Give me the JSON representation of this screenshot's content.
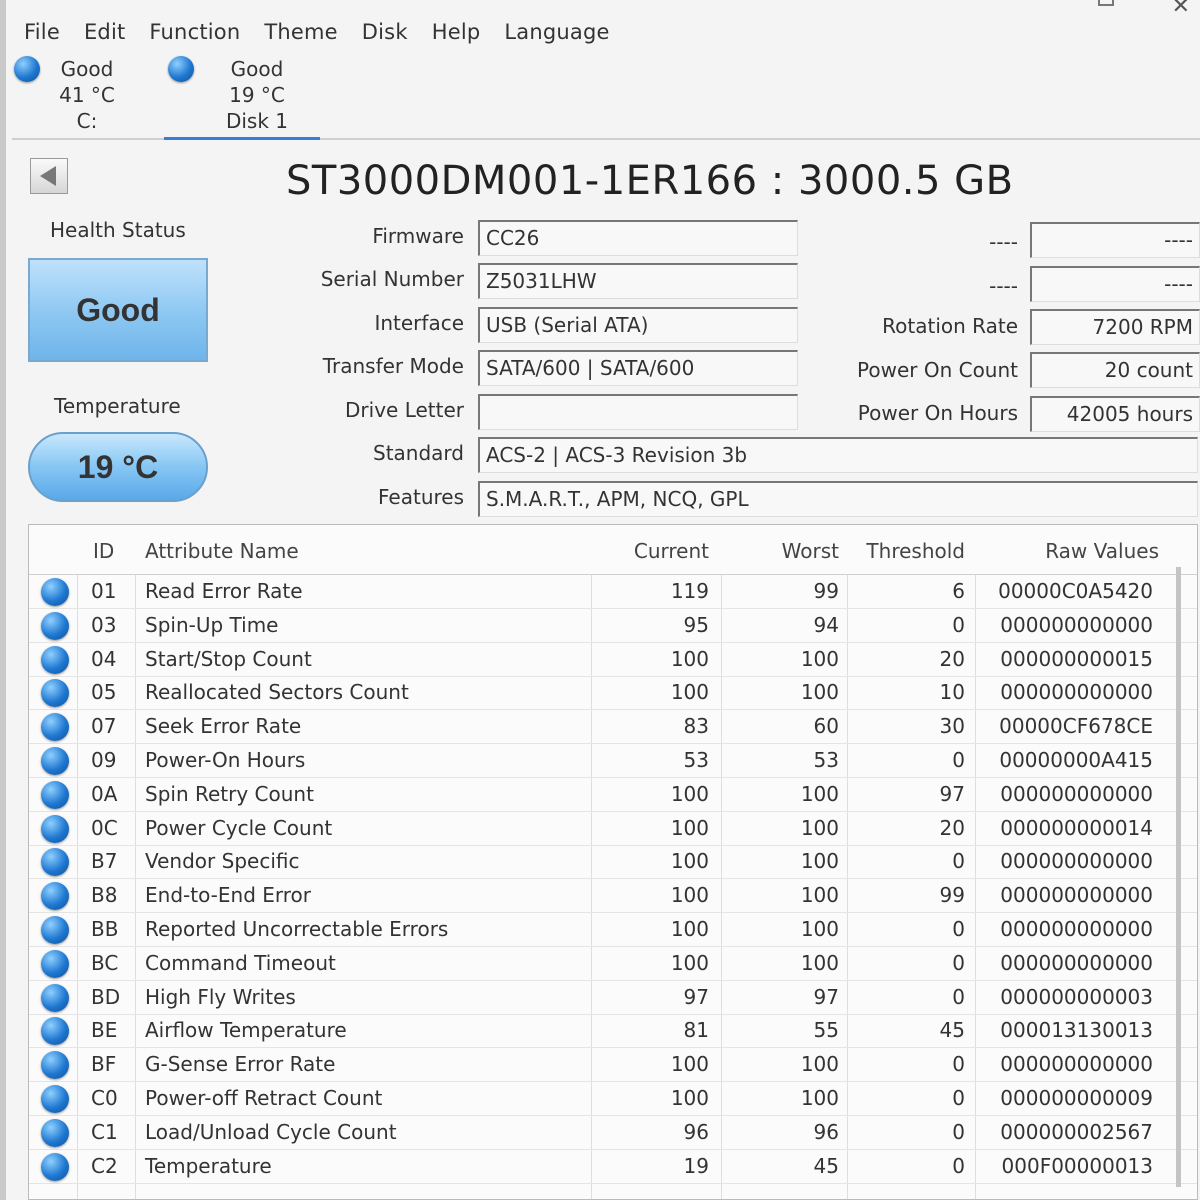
{
  "menu": [
    "File",
    "Edit",
    "Function",
    "Theme",
    "Disk",
    "Help",
    "Language"
  ],
  "disk_tabs": [
    {
      "status": "Good",
      "temp": "41 °C",
      "name": "C:"
    },
    {
      "status": "Good",
      "temp": "19 °C",
      "name": "Disk 1"
    }
  ],
  "drive": {
    "title": "ST3000DM001-1ER166 : 3000.5 GB"
  },
  "health": {
    "label": "Health Status",
    "value": "Good"
  },
  "temperature": {
    "label": "Temperature",
    "value": "19 °C"
  },
  "info": {
    "firmware_label": "Firmware",
    "firmware": "CC26",
    "serial_label": "Serial Number",
    "serial": "Z5031LHW",
    "interface_label": "Interface",
    "interface": "USB (Serial ATA)",
    "transfer_label": "Transfer Mode",
    "transfer": "SATA/600 | SATA/600",
    "drive_letter_label": "Drive Letter",
    "drive_letter": "",
    "standard_label": "Standard",
    "standard": "ACS-2 | ACS-3 Revision 3b",
    "features_label": "Features",
    "features": "S.M.A.R.T., APM, NCQ, GPL"
  },
  "right_info": {
    "blank1_label": "----",
    "blank1_value": "----",
    "blank2_label": "----",
    "blank2_value": "----",
    "rotation_label": "Rotation Rate",
    "rotation": "7200 RPM",
    "power_on_count_label": "Power On Count",
    "power_on_count": "20 count",
    "power_on_hours_label": "Power On Hours",
    "power_on_hours": "42005 hours"
  },
  "table": {
    "headers": {
      "id": "ID",
      "name": "Attribute Name",
      "current": "Current",
      "worst": "Worst",
      "threshold": "Threshold",
      "raw": "Raw Values"
    },
    "rows": [
      {
        "id": "01",
        "name": "Read Error Rate",
        "current": "119",
        "worst": "99",
        "threshold": "6",
        "raw": "00000C0A5420"
      },
      {
        "id": "03",
        "name": "Spin-Up Time",
        "current": "95",
        "worst": "94",
        "threshold": "0",
        "raw": "000000000000"
      },
      {
        "id": "04",
        "name": "Start/Stop Count",
        "current": "100",
        "worst": "100",
        "threshold": "20",
        "raw": "000000000015"
      },
      {
        "id": "05",
        "name": "Reallocated Sectors Count",
        "current": "100",
        "worst": "100",
        "threshold": "10",
        "raw": "000000000000"
      },
      {
        "id": "07",
        "name": "Seek Error Rate",
        "current": "83",
        "worst": "60",
        "threshold": "30",
        "raw": "00000CF678CE"
      },
      {
        "id": "09",
        "name": "Power-On Hours",
        "current": "53",
        "worst": "53",
        "threshold": "0",
        "raw": "00000000A415"
      },
      {
        "id": "0A",
        "name": "Spin Retry Count",
        "current": "100",
        "worst": "100",
        "threshold": "97",
        "raw": "000000000000"
      },
      {
        "id": "0C",
        "name": "Power Cycle Count",
        "current": "100",
        "worst": "100",
        "threshold": "20",
        "raw": "000000000014"
      },
      {
        "id": "B7",
        "name": "Vendor Specific",
        "current": "100",
        "worst": "100",
        "threshold": "0",
        "raw": "000000000000"
      },
      {
        "id": "B8",
        "name": "End-to-End Error",
        "current": "100",
        "worst": "100",
        "threshold": "99",
        "raw": "000000000000"
      },
      {
        "id": "BB",
        "name": "Reported Uncorrectable Errors",
        "current": "100",
        "worst": "100",
        "threshold": "0",
        "raw": "000000000000"
      },
      {
        "id": "BC",
        "name": "Command Timeout",
        "current": "100",
        "worst": "100",
        "threshold": "0",
        "raw": "000000000000"
      },
      {
        "id": "BD",
        "name": "High Fly Writes",
        "current": "97",
        "worst": "97",
        "threshold": "0",
        "raw": "000000000003"
      },
      {
        "id": "BE",
        "name": "Airflow Temperature",
        "current": "81",
        "worst": "55",
        "threshold": "45",
        "raw": "000013130013"
      },
      {
        "id": "BF",
        "name": "G-Sense Error Rate",
        "current": "100",
        "worst": "100",
        "threshold": "0",
        "raw": "000000000000"
      },
      {
        "id": "C0",
        "name": "Power-off Retract Count",
        "current": "100",
        "worst": "100",
        "threshold": "0",
        "raw": "000000000009"
      },
      {
        "id": "C1",
        "name": "Load/Unload Cycle Count",
        "current": "96",
        "worst": "96",
        "threshold": "0",
        "raw": "000000002567"
      },
      {
        "id": "C2",
        "name": "Temperature",
        "current": "19",
        "worst": "45",
        "threshold": "0",
        "raw": "000F00000013"
      }
    ]
  },
  "colors": {
    "status_good": "#1f78d1",
    "health_box": "#8cc7f2"
  }
}
